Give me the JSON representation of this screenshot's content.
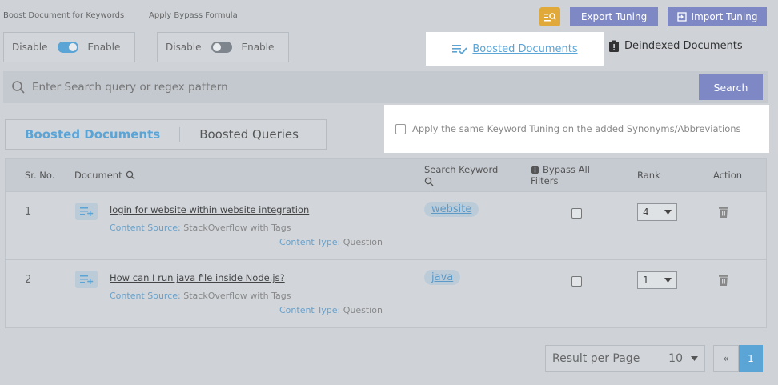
{
  "header": {
    "boost_label": "Boost Document for Keywords",
    "bypass_label": "Apply Bypass Formula",
    "export_label": "Export Tuning",
    "import_label": "Import Tuning"
  },
  "toggles": {
    "boost": {
      "off": "Disable",
      "on": "Enable",
      "state": "on"
    },
    "bypass": {
      "off": "Disable",
      "on": "Enable",
      "state": "off"
    }
  },
  "tabs": {
    "boosted": "Boosted Documents",
    "deindexed": "Deindexed Documents"
  },
  "search": {
    "placeholder": "Enter Search query or regex pattern",
    "button": "Search"
  },
  "subtabs": {
    "documents": "Boosted Documents",
    "queries": "Boosted Queries"
  },
  "synonym_option": "Apply the same Keyword Tuning on the added Synonyms/Abbreviations",
  "table": {
    "headers": {
      "sr": "Sr. No.",
      "document": "Document",
      "keyword": "Search Keyword",
      "bypass_line1": "Bypass All",
      "bypass_line2": "Filters",
      "rank": "Rank",
      "action": "Action"
    },
    "rows": [
      {
        "sr": "1",
        "title": "login for website within website integration",
        "source_label": "Content Source:",
        "source": "StackOverflow with Tags",
        "type_label": "Content Type:",
        "type": "Question",
        "keyword": "website",
        "rank": "4"
      },
      {
        "sr": "2",
        "title": "How can I run java file inside Node.js?",
        "source_label": "Content Source:",
        "source": "StackOverflow with Tags",
        "type_label": "Content Type:",
        "type": "Question",
        "keyword": "java",
        "rank": "1"
      }
    ]
  },
  "pagination": {
    "per_page_label": "Result per Page",
    "per_page": "10",
    "prev": "«",
    "current": "1"
  },
  "colors": {
    "accent": "#5ba4d6",
    "button": "#7d88c4",
    "highlight": "#ffffff",
    "warn_icon": "#e0a93a"
  }
}
